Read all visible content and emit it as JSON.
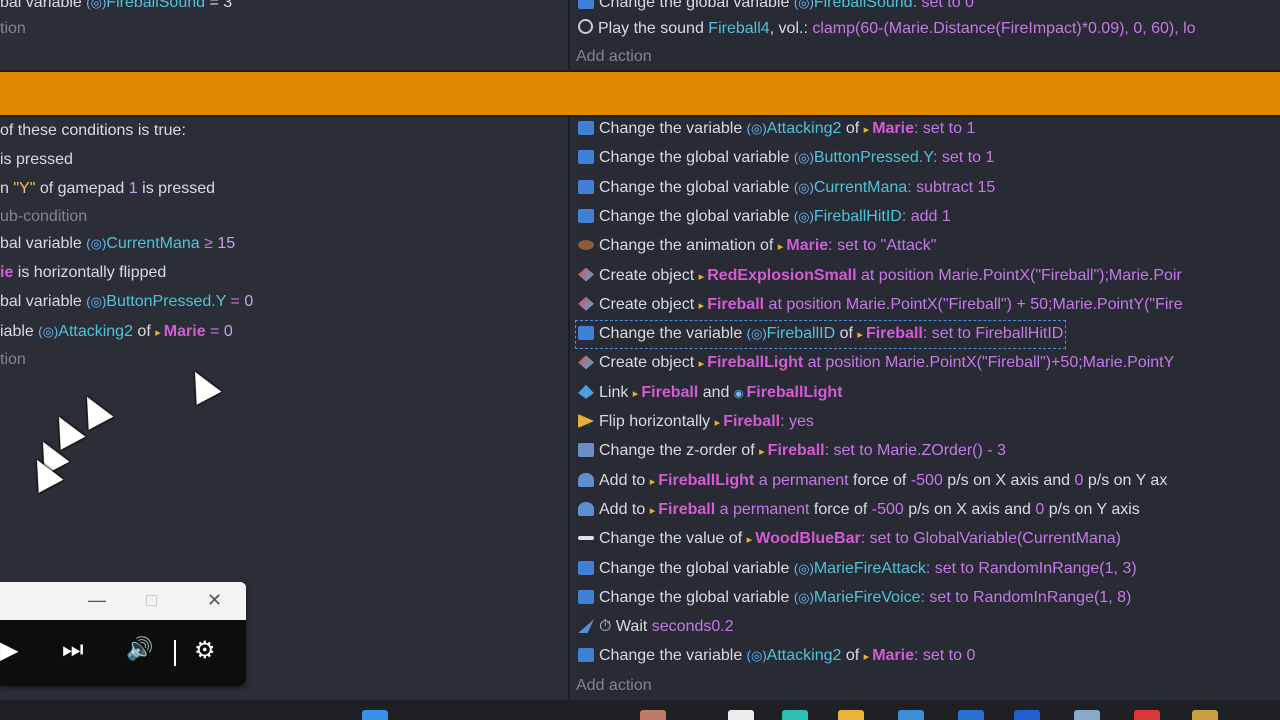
{
  "left_panel": {
    "top_lines": [
      {
        "prefix": "bal variable ",
        "var": "FireballSound",
        "rest": " = 3"
      },
      {
        "text": "tion"
      }
    ],
    "conditions": [
      {
        "text": "of these conditions is true:"
      },
      {
        "text": "is pressed"
      },
      {
        "prefix": "n ",
        "quoted": "\"Y\"",
        "mid": " of gamepad ",
        "num": "1",
        "rest": " is pressed"
      },
      {
        "text": "ub-condition"
      },
      {
        "prefix": "bal variable ",
        "var": "CurrentMana",
        "op": " ≥ ",
        "num": "15"
      },
      {
        "obj": "ie",
        "rest": " is horizontally flipped"
      },
      {
        "prefix": "bal variable ",
        "var": "ButtonPressed.Y",
        "op": " = ",
        "num": "0"
      },
      {
        "prefix": "iable ",
        "var": "Attacking2",
        "mid": " of ",
        "obj": "Marie",
        "op": " = ",
        "num": "0"
      },
      {
        "text": "tion"
      }
    ]
  },
  "right_panel": {
    "top_actions": [
      {
        "text": "Change the global variable ",
        "var": "FireballSound",
        "rest": ": set to 0"
      },
      {
        "text": "Play the sound ",
        "cyan": "Fireball4",
        "mid": ", vol.: ",
        "expr": "clamp(60-(Marie.Distance(FireImpact)*0.09), 0, 60), lo"
      },
      {
        "add": "Add action"
      }
    ],
    "actions": [
      {
        "icon": "var",
        "a": "Change the variable ",
        "var": "Attacking2",
        "b": " of ",
        "obj": "Marie",
        "c": ": set to ",
        "val": "1"
      },
      {
        "icon": "var",
        "a": "Change the global variable ",
        "var": "ButtonPressed.Y",
        "c": ": set to ",
        "val": "1"
      },
      {
        "icon": "var",
        "a": "Change the global variable ",
        "var": "CurrentMana",
        "c": ": subtract ",
        "val": "15"
      },
      {
        "icon": "var",
        "a": "Change the global variable ",
        "var": "FireballHitID",
        "c": ": add ",
        "val": "1"
      },
      {
        "icon": "anim",
        "a": "Change the animation of ",
        "obj": "Marie",
        "c": ": set to ",
        "val": "\"Attack\""
      },
      {
        "icon": "obj",
        "a": "Create object ",
        "obj": "RedExplosionSmall",
        "c": " at position ",
        "val": "Marie.PointX(\"Fireball\");Marie.Poir"
      },
      {
        "icon": "obj",
        "a": "Create object ",
        "obj": "Fireball",
        "c": " at position ",
        "val": "Marie.PointX(\"Fireball\") + 50;Marie.PointY(\"Fire"
      },
      {
        "icon": "var",
        "a": "Change the variable ",
        "var": "FireballID",
        "b": " of ",
        "obj": "Fireball",
        "c": ": set to ",
        "val": "FireballHitID",
        "selected": true
      },
      {
        "icon": "obj",
        "a": "Create object ",
        "obj": "FireballLight",
        "c": " at position ",
        "val": "Marie.PointX(\"Fireball\")+50;Marie.PointY"
      },
      {
        "icon": "link",
        "a": "Link ",
        "obj": "Fireball",
        "b2": " and ",
        "obj2": "FireballLight"
      },
      {
        "icon": "flip",
        "a": "Flip horizontally ",
        "obj": "Fireball",
        "c": ": ",
        "val": "yes"
      },
      {
        "icon": "z",
        "a": "Change the z-order of ",
        "obj": "Fireball",
        "c": ": set to ",
        "val": "Marie.ZOrder() - 3"
      },
      {
        "icon": "force",
        "a": "Add to ",
        "obj": "FireballLight",
        "c": " a permanent ",
        "d": "force of ",
        "val": "-500",
        "e": " p/s on X axis and ",
        "val2": "0",
        "f": " p/s on Y ax"
      },
      {
        "icon": "force",
        "a": "Add to ",
        "obj": "Fireball",
        "c": " a permanent ",
        "d": "force of ",
        "val": "-500",
        "e": " p/s on X axis and ",
        "val2": "0",
        "f": " p/s on Y axis"
      },
      {
        "icon": "bar",
        "a": "Change the value of ",
        "obj": "WoodBlueBar",
        "c": ": set to ",
        "val": "GlobalVariable(CurrentMana)"
      },
      {
        "icon": "var",
        "a": "Change the global variable ",
        "var": "MarieFireAttack",
        "c": ": set to ",
        "val": "RandomInRange(1, 3)"
      },
      {
        "icon": "var",
        "a": "Change the global variable ",
        "var": "MarieFireVoice",
        "c": ": set to ",
        "val": "RandomInRange(1, 8)"
      },
      {
        "icon": "wait",
        "a": "⏱ Wait ",
        "val": "0.2",
        "c": " seconds"
      },
      {
        "icon": "var",
        "a": "Change the variable ",
        "var": "Attacking2",
        "b": " of ",
        "obj": "Marie",
        "c": ": set to ",
        "val": "0"
      }
    ],
    "add_action": "Add action"
  },
  "media_player": {
    "minimize": "—",
    "maximize": "□",
    "close": "✕",
    "play": "▶",
    "next": "⏭",
    "volume": "🔊",
    "settings": "⚙"
  }
}
